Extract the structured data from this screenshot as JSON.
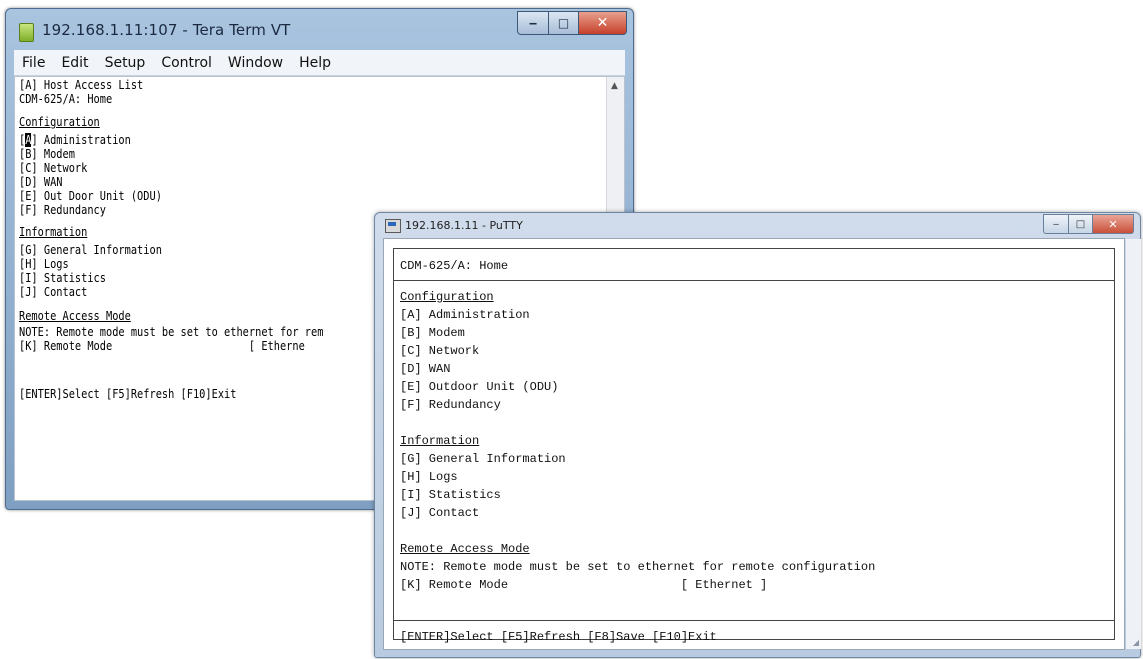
{
  "teraterm": {
    "title": "192.168.1.11:107 - Tera Term VT",
    "caption": {
      "min": "‒",
      "max": "□",
      "close": "✕"
    },
    "menu": [
      "File",
      "Edit",
      "Setup",
      "Control",
      "Window",
      "Help"
    ],
    "lines": {
      "l1": "[A] Host Access List",
      "l2": "CDM-625/A: Home",
      "config_heading": "Configuration",
      "cursor_char": "A",
      "a_rest": "] Administration",
      "b": "[B] Modem",
      "c": "[C] Network",
      "d": "[D] WAN",
      "e": "[E] Out Door Unit (ODU)",
      "f": "[F] Redundancy",
      "info_heading": "Information",
      "g": "[G] General Information",
      "h": "[H] Logs",
      "i": "[I] Statistics",
      "j": "[J] Contact",
      "remote_heading": "Remote Access Mode",
      "note": "NOTE: Remote mode must be set to ethernet for rem",
      "k": "[K] Remote Mode                      [ Etherne",
      "footer": "[ENTER]Select [F5]Refresh [F10]Exit"
    }
  },
  "putty": {
    "title": "192.168.1.11 - PuTTY",
    "caption": {
      "min": "‒",
      "max": "□",
      "close": "✕"
    },
    "lines": {
      "header": "CDM-625/A: Home",
      "config_heading": "Configuration",
      "a": "[A] Administration",
      "b": "[B] Modem",
      "c": "[C] Network",
      "d": "[D] WAN",
      "e": "[E] Outdoor Unit (ODU)",
      "f": "[F] Redundancy",
      "info_heading": "Information",
      "g": "[G] General Information",
      "h": "[H] Logs",
      "i": "[I] Statistics",
      "j": "[J] Contact",
      "remote_heading": "Remote Access Mode",
      "note": "NOTE: Remote mode must be set to ethernet for remote configuration",
      "k": "[K] Remote Mode                        [ Ethernet ]",
      "footer": "[ENTER]Select [F5]Refresh [F8]Save [F10]Exit"
    }
  }
}
